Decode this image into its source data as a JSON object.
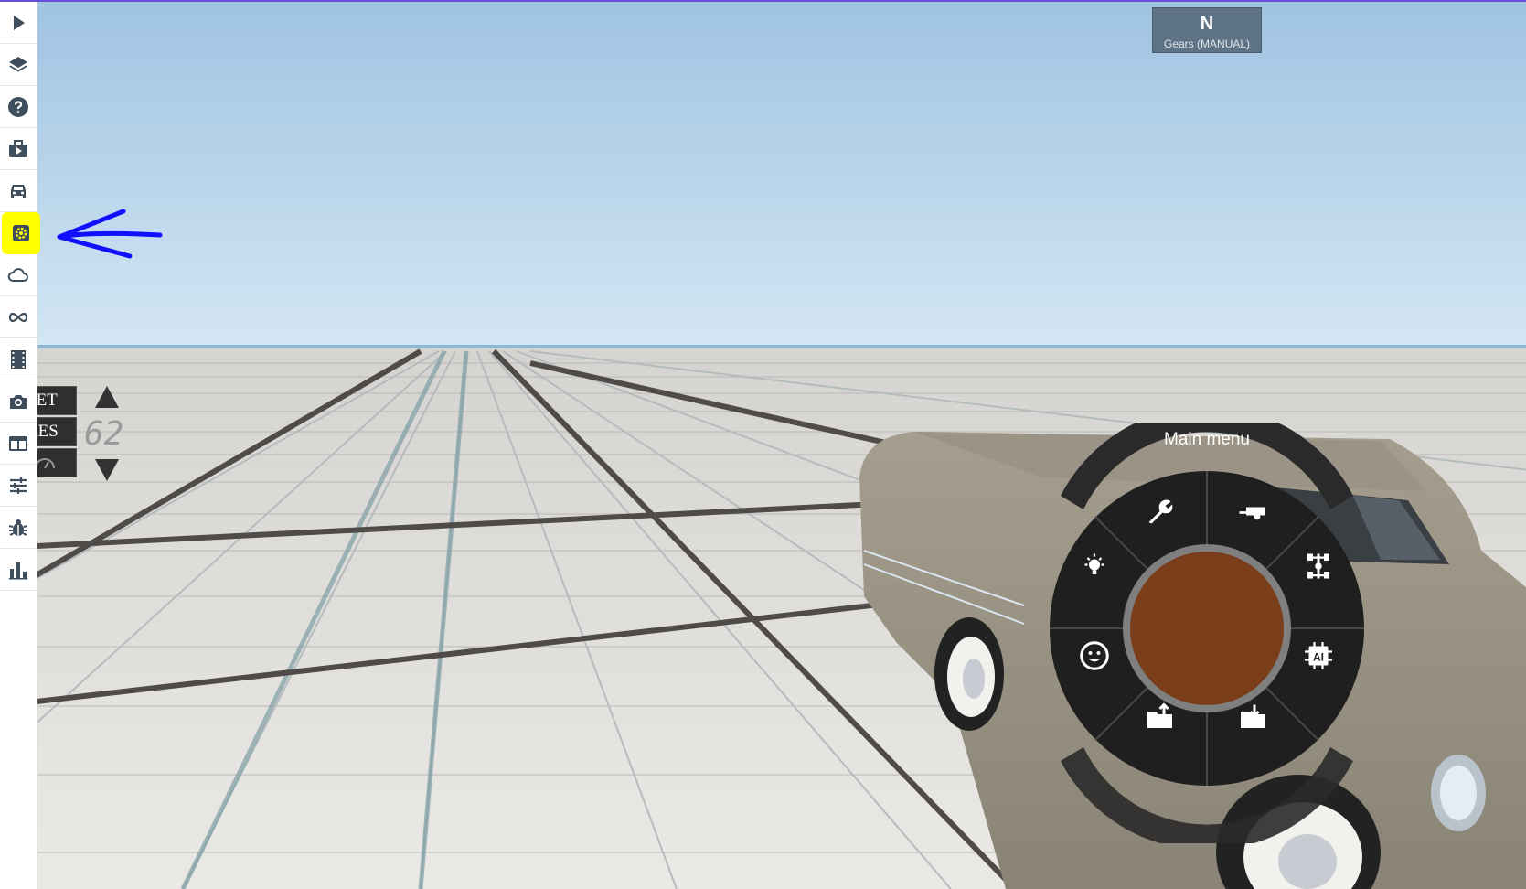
{
  "colors": {
    "sky_top": "#9fc3e2",
    "sky_bottom": "#cfe3f1",
    "ground": "#e6e4e0",
    "sidebar_icon": "#3e4e5c",
    "highlight": "#ffff00",
    "annotation": "#1010ff",
    "radial_center": "#7a3f1a"
  },
  "sidebar": {
    "items": [
      {
        "icon": "play-icon"
      },
      {
        "icon": "layers-icon"
      },
      {
        "icon": "help-icon"
      },
      {
        "icon": "scenario-icon"
      },
      {
        "icon": "car-icon"
      },
      {
        "icon": "settings-gear-icon",
        "active": true
      },
      {
        "icon": "cloud-icon"
      },
      {
        "icon": "infinity-icon"
      },
      {
        "icon": "film-icon"
      },
      {
        "icon": "camera-icon"
      },
      {
        "icon": "layout-icon"
      },
      {
        "icon": "sliders-icon"
      },
      {
        "icon": "bug-icon"
      },
      {
        "icon": "bar-chart-icon"
      }
    ]
  },
  "gear_indicator": {
    "value": "N",
    "label": "Gears (MANUAL)"
  },
  "cruise_control": {
    "set_label": "SET",
    "res_label": "RES",
    "speed": "62"
  },
  "radial_menu": {
    "title": "Main menu",
    "items": [
      {
        "icon": "wrench-icon"
      },
      {
        "icon": "trailer-icon"
      },
      {
        "icon": "powertrain-icon"
      },
      {
        "icon": "ai-chip-icon"
      },
      {
        "icon": "folder-load-icon"
      },
      {
        "icon": "folder-save-icon"
      },
      {
        "icon": "emoji-icon"
      },
      {
        "icon": "lightbulb-icon"
      }
    ]
  }
}
